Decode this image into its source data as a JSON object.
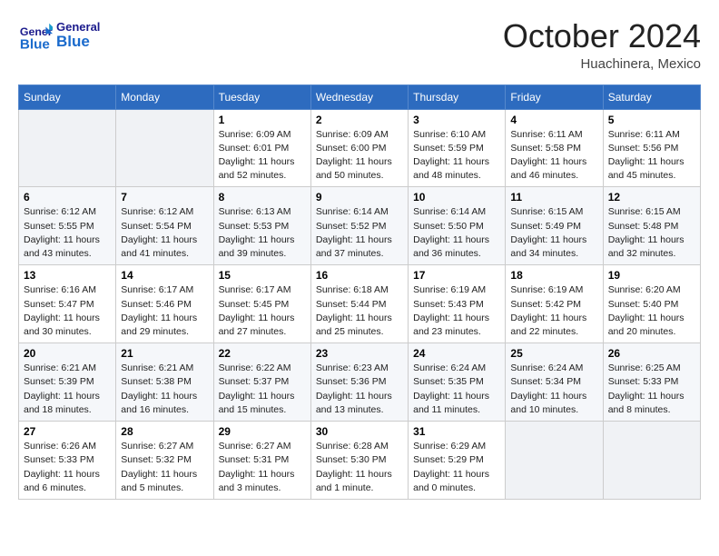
{
  "header": {
    "logo_general": "General",
    "logo_blue": "Blue",
    "month_title": "October 2024",
    "subtitle": "Huachinera, Mexico"
  },
  "days_of_week": [
    "Sunday",
    "Monday",
    "Tuesday",
    "Wednesday",
    "Thursday",
    "Friday",
    "Saturday"
  ],
  "weeks": [
    [
      {
        "day": "",
        "sunrise": "",
        "sunset": "",
        "daylight": ""
      },
      {
        "day": "",
        "sunrise": "",
        "sunset": "",
        "daylight": ""
      },
      {
        "day": "1",
        "sunrise": "Sunrise: 6:09 AM",
        "sunset": "Sunset: 6:01 PM",
        "daylight": "Daylight: 11 hours and 52 minutes."
      },
      {
        "day": "2",
        "sunrise": "Sunrise: 6:09 AM",
        "sunset": "Sunset: 6:00 PM",
        "daylight": "Daylight: 11 hours and 50 minutes."
      },
      {
        "day": "3",
        "sunrise": "Sunrise: 6:10 AM",
        "sunset": "Sunset: 5:59 PM",
        "daylight": "Daylight: 11 hours and 48 minutes."
      },
      {
        "day": "4",
        "sunrise": "Sunrise: 6:11 AM",
        "sunset": "Sunset: 5:58 PM",
        "daylight": "Daylight: 11 hours and 46 minutes."
      },
      {
        "day": "5",
        "sunrise": "Sunrise: 6:11 AM",
        "sunset": "Sunset: 5:56 PM",
        "daylight": "Daylight: 11 hours and 45 minutes."
      }
    ],
    [
      {
        "day": "6",
        "sunrise": "Sunrise: 6:12 AM",
        "sunset": "Sunset: 5:55 PM",
        "daylight": "Daylight: 11 hours and 43 minutes."
      },
      {
        "day": "7",
        "sunrise": "Sunrise: 6:12 AM",
        "sunset": "Sunset: 5:54 PM",
        "daylight": "Daylight: 11 hours and 41 minutes."
      },
      {
        "day": "8",
        "sunrise": "Sunrise: 6:13 AM",
        "sunset": "Sunset: 5:53 PM",
        "daylight": "Daylight: 11 hours and 39 minutes."
      },
      {
        "day": "9",
        "sunrise": "Sunrise: 6:14 AM",
        "sunset": "Sunset: 5:52 PM",
        "daylight": "Daylight: 11 hours and 37 minutes."
      },
      {
        "day": "10",
        "sunrise": "Sunrise: 6:14 AM",
        "sunset": "Sunset: 5:50 PM",
        "daylight": "Daylight: 11 hours and 36 minutes."
      },
      {
        "day": "11",
        "sunrise": "Sunrise: 6:15 AM",
        "sunset": "Sunset: 5:49 PM",
        "daylight": "Daylight: 11 hours and 34 minutes."
      },
      {
        "day": "12",
        "sunrise": "Sunrise: 6:15 AM",
        "sunset": "Sunset: 5:48 PM",
        "daylight": "Daylight: 11 hours and 32 minutes."
      }
    ],
    [
      {
        "day": "13",
        "sunrise": "Sunrise: 6:16 AM",
        "sunset": "Sunset: 5:47 PM",
        "daylight": "Daylight: 11 hours and 30 minutes."
      },
      {
        "day": "14",
        "sunrise": "Sunrise: 6:17 AM",
        "sunset": "Sunset: 5:46 PM",
        "daylight": "Daylight: 11 hours and 29 minutes."
      },
      {
        "day": "15",
        "sunrise": "Sunrise: 6:17 AM",
        "sunset": "Sunset: 5:45 PM",
        "daylight": "Daylight: 11 hours and 27 minutes."
      },
      {
        "day": "16",
        "sunrise": "Sunrise: 6:18 AM",
        "sunset": "Sunset: 5:44 PM",
        "daylight": "Daylight: 11 hours and 25 minutes."
      },
      {
        "day": "17",
        "sunrise": "Sunrise: 6:19 AM",
        "sunset": "Sunset: 5:43 PM",
        "daylight": "Daylight: 11 hours and 23 minutes."
      },
      {
        "day": "18",
        "sunrise": "Sunrise: 6:19 AM",
        "sunset": "Sunset: 5:42 PM",
        "daylight": "Daylight: 11 hours and 22 minutes."
      },
      {
        "day": "19",
        "sunrise": "Sunrise: 6:20 AM",
        "sunset": "Sunset: 5:40 PM",
        "daylight": "Daylight: 11 hours and 20 minutes."
      }
    ],
    [
      {
        "day": "20",
        "sunrise": "Sunrise: 6:21 AM",
        "sunset": "Sunset: 5:39 PM",
        "daylight": "Daylight: 11 hours and 18 minutes."
      },
      {
        "day": "21",
        "sunrise": "Sunrise: 6:21 AM",
        "sunset": "Sunset: 5:38 PM",
        "daylight": "Daylight: 11 hours and 16 minutes."
      },
      {
        "day": "22",
        "sunrise": "Sunrise: 6:22 AM",
        "sunset": "Sunset: 5:37 PM",
        "daylight": "Daylight: 11 hours and 15 minutes."
      },
      {
        "day": "23",
        "sunrise": "Sunrise: 6:23 AM",
        "sunset": "Sunset: 5:36 PM",
        "daylight": "Daylight: 11 hours and 13 minutes."
      },
      {
        "day": "24",
        "sunrise": "Sunrise: 6:24 AM",
        "sunset": "Sunset: 5:35 PM",
        "daylight": "Daylight: 11 hours and 11 minutes."
      },
      {
        "day": "25",
        "sunrise": "Sunrise: 6:24 AM",
        "sunset": "Sunset: 5:34 PM",
        "daylight": "Daylight: 11 hours and 10 minutes."
      },
      {
        "day": "26",
        "sunrise": "Sunrise: 6:25 AM",
        "sunset": "Sunset: 5:33 PM",
        "daylight": "Daylight: 11 hours and 8 minutes."
      }
    ],
    [
      {
        "day": "27",
        "sunrise": "Sunrise: 6:26 AM",
        "sunset": "Sunset: 5:33 PM",
        "daylight": "Daylight: 11 hours and 6 minutes."
      },
      {
        "day": "28",
        "sunrise": "Sunrise: 6:27 AM",
        "sunset": "Sunset: 5:32 PM",
        "daylight": "Daylight: 11 hours and 5 minutes."
      },
      {
        "day": "29",
        "sunrise": "Sunrise: 6:27 AM",
        "sunset": "Sunset: 5:31 PM",
        "daylight": "Daylight: 11 hours and 3 minutes."
      },
      {
        "day": "30",
        "sunrise": "Sunrise: 6:28 AM",
        "sunset": "Sunset: 5:30 PM",
        "daylight": "Daylight: 11 hours and 1 minute."
      },
      {
        "day": "31",
        "sunrise": "Sunrise: 6:29 AM",
        "sunset": "Sunset: 5:29 PM",
        "daylight": "Daylight: 11 hours and 0 minutes."
      },
      {
        "day": "",
        "sunrise": "",
        "sunset": "",
        "daylight": ""
      },
      {
        "day": "",
        "sunrise": "",
        "sunset": "",
        "daylight": ""
      }
    ]
  ]
}
